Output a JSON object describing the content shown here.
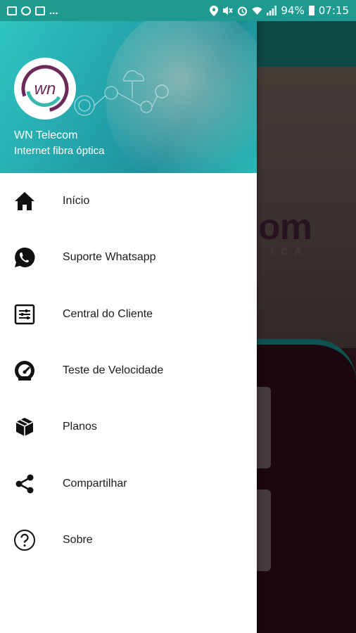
{
  "status_bar": {
    "left_dots": "...",
    "battery": "94%",
    "time": "07:15"
  },
  "drawer": {
    "header": {
      "logo_text": "wn",
      "title": "WN Telecom",
      "subtitle": "Internet fibra óptica"
    },
    "items": [
      {
        "label": "Início",
        "icon": "home-icon"
      },
      {
        "label": "Suporte Whatsapp",
        "icon": "whatsapp-icon"
      },
      {
        "label": "Central do Cliente",
        "icon": "sliders-icon"
      },
      {
        "label": "Teste de Velocidade",
        "icon": "speedometer-icon"
      },
      {
        "label": "Planos",
        "icon": "package-icon"
      },
      {
        "label": "Compartilhar",
        "icon": "share-icon"
      },
      {
        "label": "Sobre",
        "icon": "help-icon"
      }
    ]
  },
  "background": {
    "logo_fragment": "om",
    "logo_sub_fragment": "ICA"
  },
  "colors": {
    "status_bar": "#1f9a90",
    "header_teal": "#26aab0",
    "logo_purple": "#6b2a5a",
    "icon": "#111111"
  }
}
